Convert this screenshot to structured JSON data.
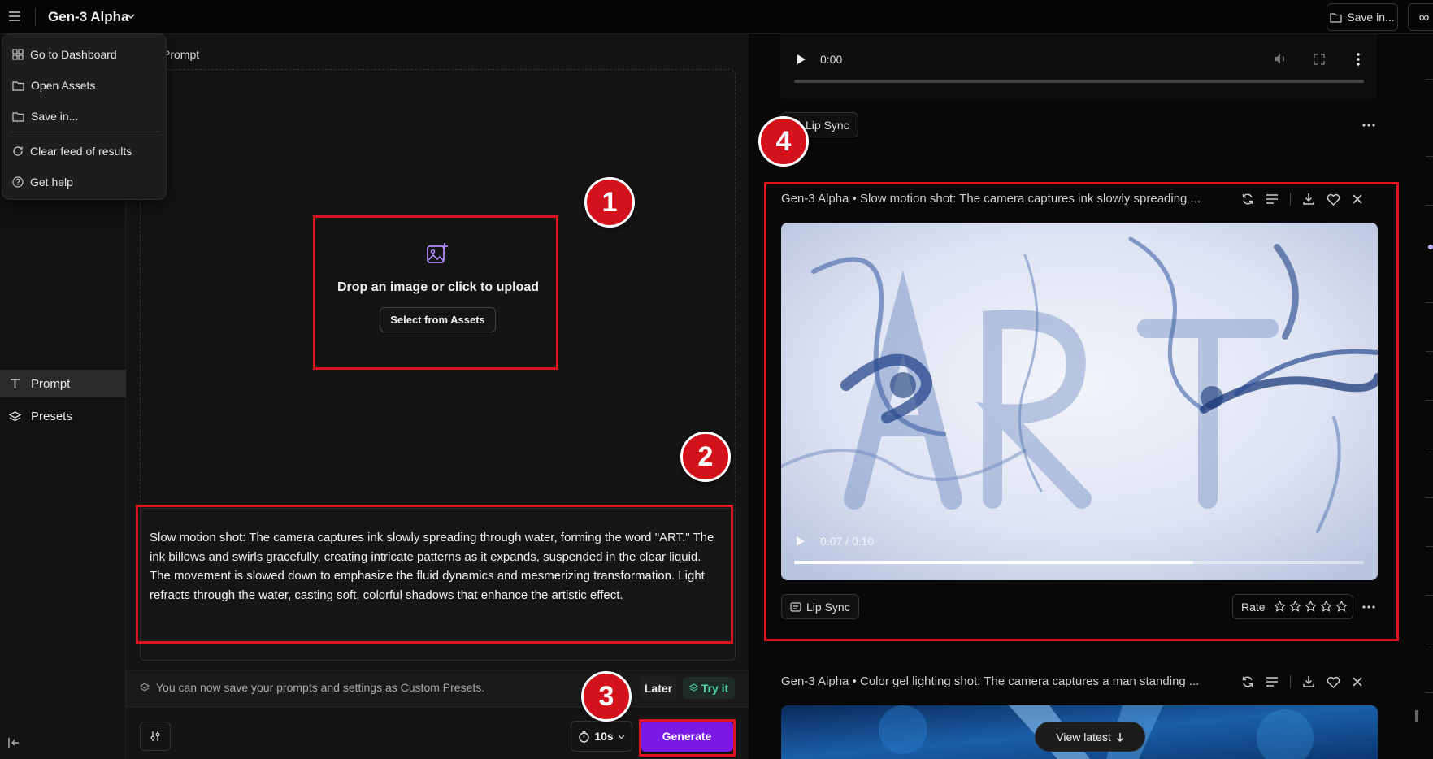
{
  "header": {
    "app_title": "Gen-3 Alpha",
    "save_label": "Save in..."
  },
  "menu": {
    "items": [
      {
        "label": "Go to Dashboard",
        "icon": "grid-icon"
      },
      {
        "label": "Open Assets",
        "icon": "folder-icon"
      },
      {
        "label": "Save in...",
        "icon": "folder-icon"
      },
      {
        "label": "Clear feed of results",
        "icon": "refresh-icon"
      },
      {
        "label": "Get help",
        "icon": "help-circle-icon"
      }
    ]
  },
  "sidebar": {
    "items": [
      {
        "label": "Prompt",
        "icon": "text-icon",
        "active": true
      },
      {
        "label": "Presets",
        "icon": "layers-icon",
        "active": false
      }
    ]
  },
  "prompt_panel": {
    "heading": "Prompt",
    "upload_text": "Drop an image or click to upload",
    "assets_button": "Select from Assets",
    "prompt_text": "Slow motion shot: The camera captures ink slowly spreading through water, forming the word \"ART.\" The ink billows and swirls gracefully, creating intricate patterns as it expands, suspended in the clear liquid. The movement is slowed down to emphasize the fluid dynamics and mesmerizing transformation. Light refracts through the water, casting soft, colorful shadows that enhance the artistic effect.",
    "info_text": "You can now save your prompts and settings as Custom Presets.",
    "later_label": "Later",
    "tryit_label": "Try it",
    "duration_label": "10s",
    "generate_label": "Generate"
  },
  "feed": {
    "top_video": {
      "time": "0:00",
      "lip_sync_label": "Lip Sync"
    },
    "main_card": {
      "title": "Gen-3 Alpha • Slow motion shot: The camera captures ink slowly spreading ...",
      "time": "0:07 / 0:10",
      "progress": 0.7,
      "lip_sync_label": "Lip Sync",
      "rate_label": "Rate",
      "stars": 5
    },
    "next_card": {
      "title": "Gen-3 Alpha • Color gel lighting shot: The camera captures a man standing ..."
    },
    "view_latest_label": "View latest"
  },
  "annotations": [
    "1",
    "2",
    "3",
    "4"
  ],
  "colors": {
    "accent": "#7a19e6",
    "annotation_red": "#e0141e",
    "tryit_green": "#4fd1a5"
  }
}
